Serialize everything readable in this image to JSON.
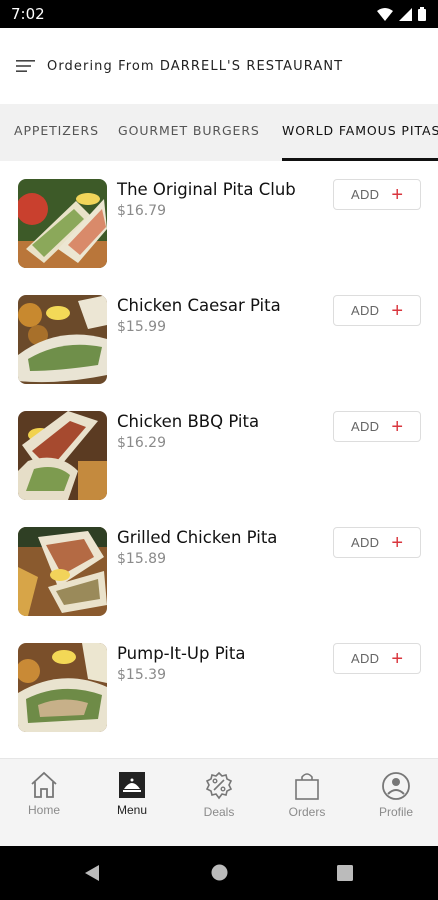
{
  "status_bar": {
    "time": "7:02"
  },
  "header": {
    "title": "Ordering From DARRELL'S RESTAURANT"
  },
  "tabs": [
    {
      "label": "APPETIZERS"
    },
    {
      "label": "GOURMET BURGERS"
    },
    {
      "label": "WORLD FAMOUS PITAS"
    }
  ],
  "items": [
    {
      "name": "The Original Pita Club",
      "price": "$16.79",
      "add_label": "ADD"
    },
    {
      "name": "Chicken Caesar Pita",
      "price": "$15.99",
      "add_label": "ADD"
    },
    {
      "name": "Chicken BBQ Pita",
      "price": "$16.29",
      "add_label": "ADD"
    },
    {
      "name": "Grilled Chicken Pita",
      "price": "$15.89",
      "add_label": "ADD"
    },
    {
      "name": "Pump-It-Up Pita",
      "price": "$15.39",
      "add_label": "ADD"
    }
  ],
  "nav": [
    {
      "label": "Home",
      "icon": "home-icon"
    },
    {
      "label": "Menu",
      "icon": "menu-icon"
    },
    {
      "label": "Deals",
      "icon": "deals-icon"
    },
    {
      "label": "Orders",
      "icon": "orders-icon"
    },
    {
      "label": "Profile",
      "icon": "profile-icon"
    }
  ],
  "colors": {
    "accent": "#d9363e",
    "tab_bg": "#f1f1f1",
    "nav_bg": "#f4f4f4"
  }
}
